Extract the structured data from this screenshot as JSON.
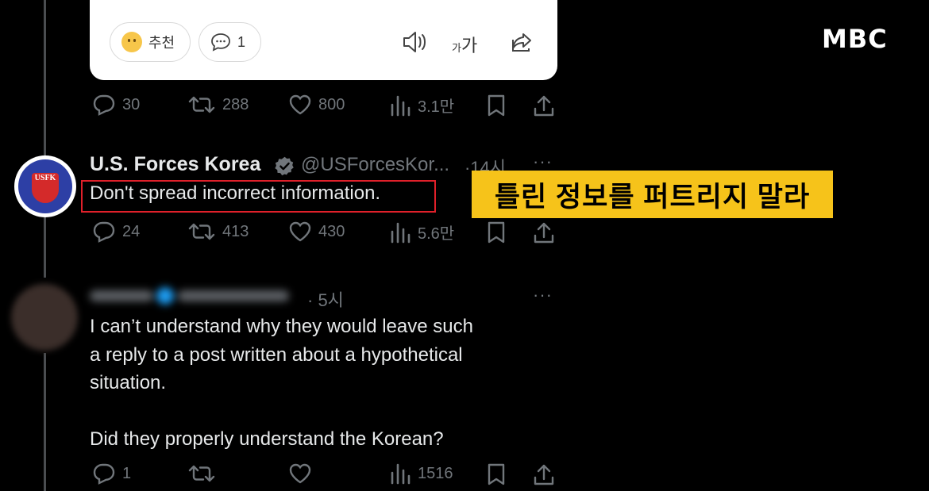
{
  "watermark": "MBC",
  "top_card": {
    "recommend_label": "추천",
    "comment_count": "1",
    "font_small": "가",
    "font_large": "가"
  },
  "first_actions": {
    "replies": "30",
    "reposts": "288",
    "likes": "800",
    "views": "3.1만"
  },
  "tweet": {
    "name": "U.S. Forces Korea",
    "handle": "@USForcesKor...",
    "time": "·14시",
    "more": "···",
    "avatar_text": "USFK",
    "text": "Don't spread incorrect information.",
    "actions": {
      "replies": "24",
      "reposts": "413",
      "likes": "430",
      "views": "5.6만"
    }
  },
  "caption": "틀린 정보를 퍼트리지 말라",
  "reply": {
    "time": "· 5시",
    "more": "···",
    "text": "I can’t understand why they would leave such\na reply to a post written about a hypothetical\nsituation.\n\nDid they properly understand the Korean?",
    "actions": {
      "replies": "1",
      "views": "1516"
    }
  },
  "colors": {
    "caption_bg": "#f6c31a",
    "highlight_border": "#e0202a",
    "muted": "#71767b",
    "verified": "#1d9bf0"
  }
}
